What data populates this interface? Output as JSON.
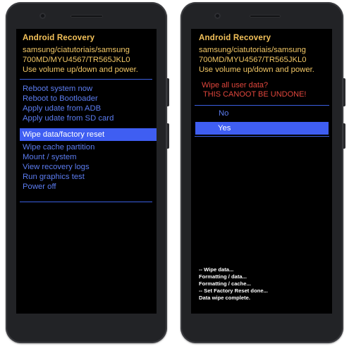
{
  "left_screen": {
    "title": "Android  Recovery",
    "header_lines": [
      "samsung/ciatutoriais/samsung",
      "700MD/MYU4567/TR565JKL0",
      "Use volume up/down and power."
    ],
    "menu": [
      "Reboot system now",
      "Reboot to Bootloader",
      "Apply udate from ADB",
      "Apply udate from SD card",
      "Wipe data/factory reset",
      "Wipe cache partition",
      "Mount / system",
      "View recovery logs",
      "Run graphics test",
      "Power off"
    ],
    "selected_index": 4
  },
  "right_screen": {
    "title": "Android  Recovery",
    "header_lines": [
      "samsung/ciatutoriais/samsung",
      "700MD/MYU4567/TR565JKL0",
      "Use volume up/down and power."
    ],
    "warning": [
      "Wipe all user data?",
      "THIS CANOOT BE UNDONE!"
    ],
    "options": [
      "No",
      "Yes"
    ],
    "selected_index": 1,
    "log_lines": [
      "-- Wipe data...",
      "Formatting / data...",
      "Formatting / cache...",
      "-- Set Factory Reset done...",
      "Data wipe complete."
    ]
  },
  "colors": {
    "title": "#f4c25a",
    "menu_text": "#5b7cf0",
    "selected_bg": "#3f5ef2",
    "warning": "#e0463c",
    "divider": "#3b5fe0"
  }
}
